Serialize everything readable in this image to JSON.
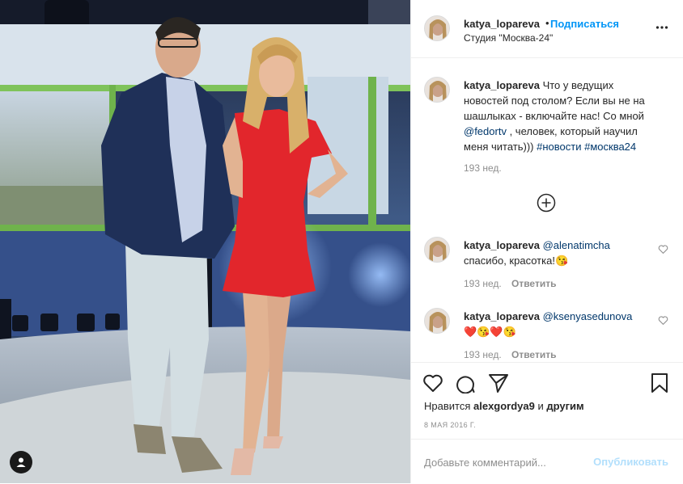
{
  "post": {
    "username": "katya_lopareva",
    "dot": "•",
    "follow_label": "Подписаться",
    "location": "Студия \"Москва-24\""
  },
  "caption": {
    "username": "katya_lopareva",
    "text_before": "Что у ведущих новостей под столом? Если вы не на шашлыках - включайте нас! Со мной",
    "mention": "@fedortv",
    "text_after": ", человек, который научил меня читать)))",
    "hashtag1": "#новости",
    "hashtag2": "#москва24",
    "age": "193 нед."
  },
  "comments": [
    {
      "username": "katya_lopareva",
      "mention": "@alenatimcha",
      "text": "спасибо, красотка!😘",
      "age": "193 нед.",
      "reply": "Ответить"
    },
    {
      "username": "katya_lopareva",
      "mention": "@ksenyasedunova",
      "text": "❤️😘❤️😘",
      "age": "193 нед.",
      "reply": "Ответить"
    }
  ],
  "likes": {
    "prefix": "Нравится",
    "user": "alexgordya9",
    "conj": "и",
    "others": "другим"
  },
  "date": "8 МАЯ 2016 Г.",
  "add_comment": {
    "placeholder": "Добавьте комментарий...",
    "publish_label": "Опубликовать"
  },
  "colors": {
    "accent": "#0095f6",
    "publish_disabled": "#b2dffc",
    "link": "#00376b",
    "muted": "#8e8e8e"
  },
  "icons": [
    "user-tag-icon",
    "more-options-icon",
    "heart-icon",
    "comment-icon",
    "share-icon",
    "bookmark-icon",
    "plus-circle-icon"
  ]
}
